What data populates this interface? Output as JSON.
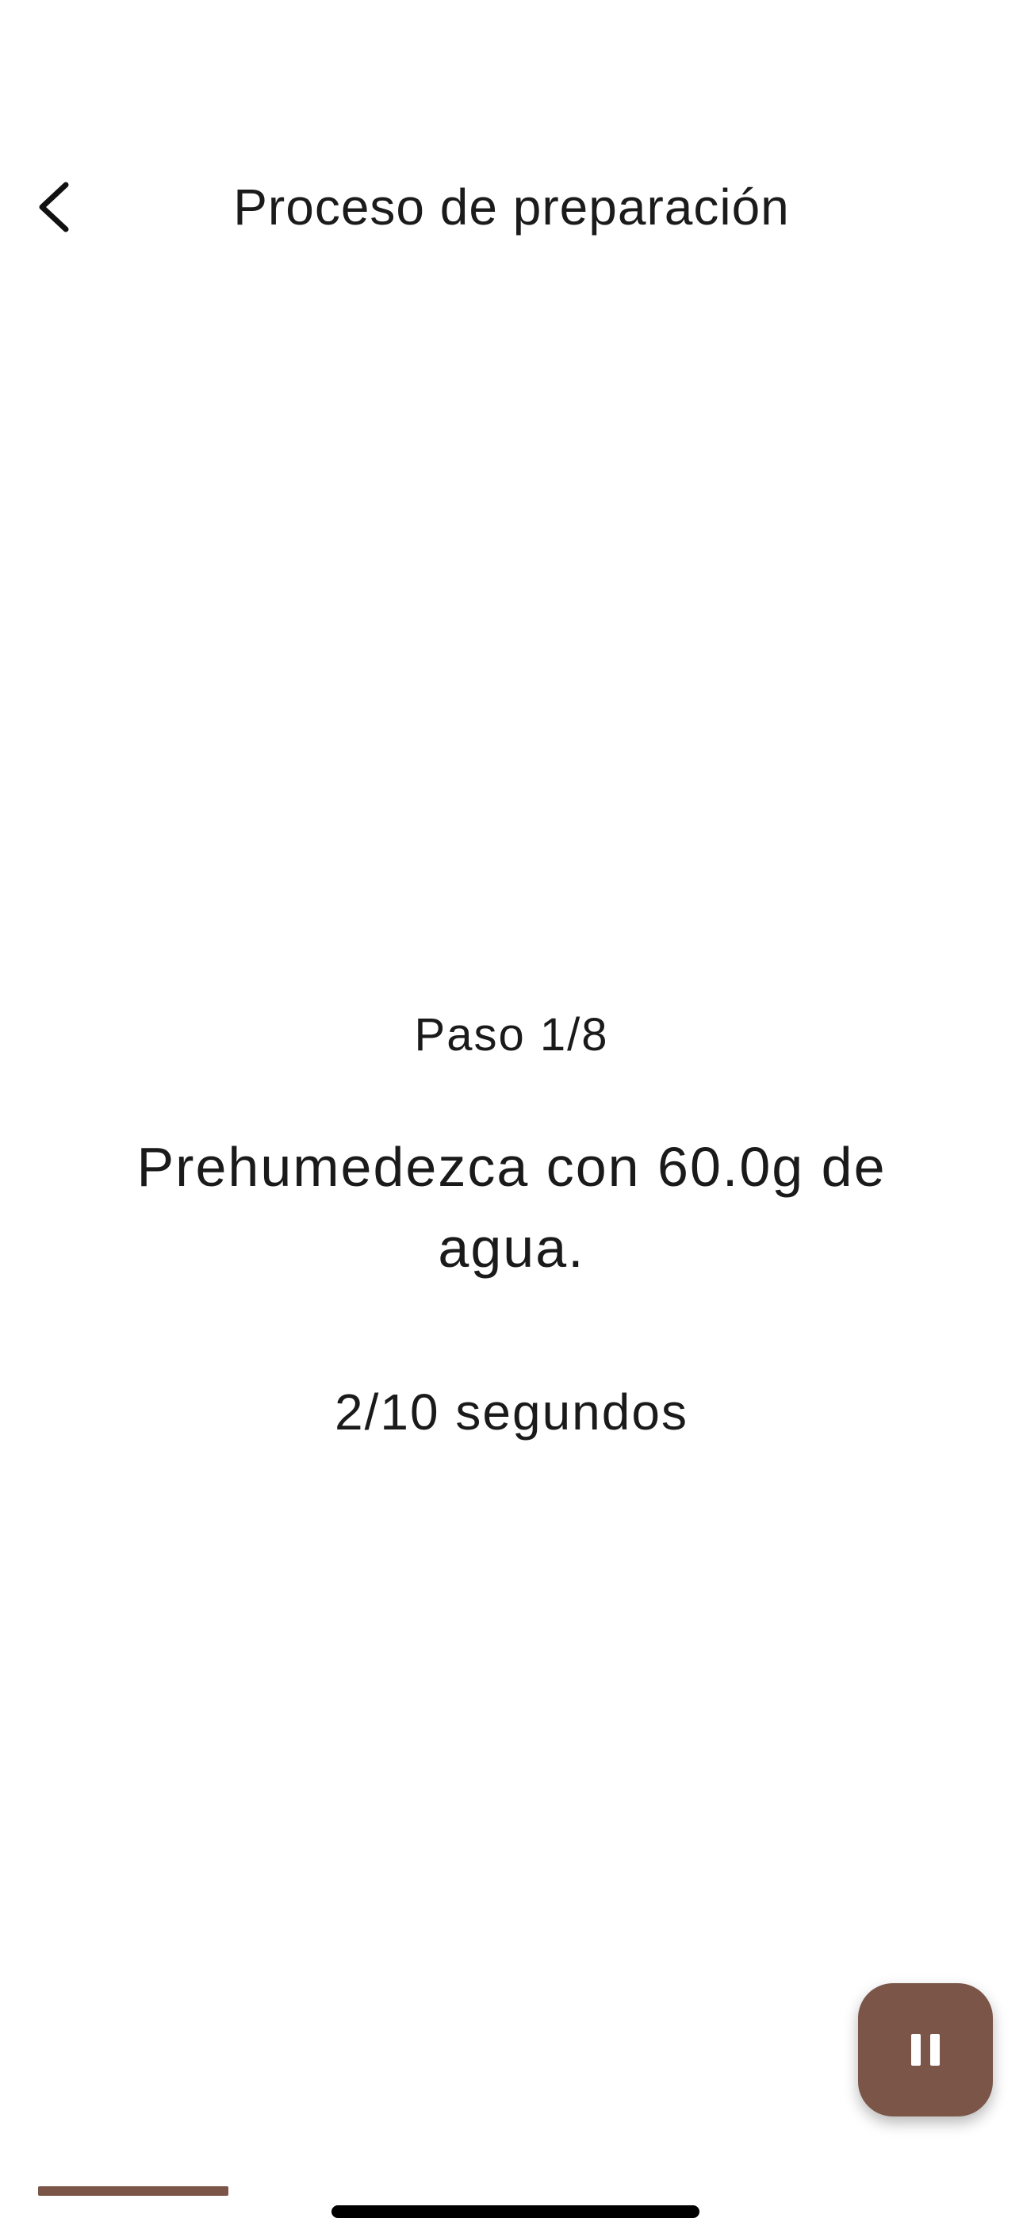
{
  "header": {
    "title": "Proceso de preparación",
    "back_icon": "chevron-left-icon"
  },
  "step": {
    "counter": "Paso 1/8",
    "instruction": "Prehumedezca con 60.0g de agua.",
    "timer": "2/10 segundos"
  },
  "controls": {
    "pause_icon": "pause-icon",
    "accent_color": "#7a5548"
  },
  "progress": {
    "fraction": 0.125
  }
}
